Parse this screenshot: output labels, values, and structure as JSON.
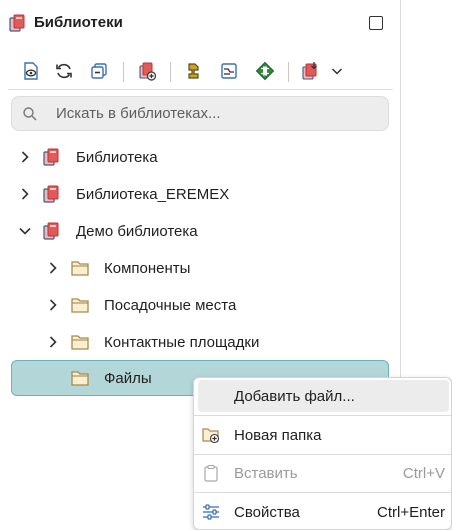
{
  "header": {
    "title": "Библиотеки",
    "icon": "library-books-icon"
  },
  "toolbar": {
    "buttons": [
      {
        "name": "view-library-icon"
      },
      {
        "name": "refresh-icon"
      },
      {
        "name": "collapse-all-icon"
      },
      {
        "name": "add-library-icon"
      },
      {
        "name": "component-icon"
      },
      {
        "name": "schematic-symbol-icon"
      },
      {
        "name": "footprint-icon"
      },
      {
        "name": "import-icon"
      },
      {
        "name": "chevron-down-icon"
      }
    ]
  },
  "search": {
    "placeholder": "Искать в библиотеках..."
  },
  "tree": {
    "items": [
      {
        "label": "Библиотека",
        "expanded": false,
        "type": "library"
      },
      {
        "label": "Библиотека_EREMEX",
        "expanded": false,
        "type": "library"
      },
      {
        "label": "Демо библиотека",
        "expanded": true,
        "type": "library"
      },
      {
        "label": "Компоненты",
        "expanded": false,
        "type": "folder"
      },
      {
        "label": "Посадочные места",
        "expanded": false,
        "type": "folder"
      },
      {
        "label": "Контактные площадки",
        "expanded": false,
        "type": "folder"
      },
      {
        "label": "Файлы",
        "expanded": false,
        "type": "folder",
        "selected": true
      }
    ]
  },
  "context_menu": {
    "items": [
      {
        "label": "Добавить файл...",
        "shortcut": "",
        "icon": "",
        "hover": true,
        "disabled": false
      },
      {
        "label": "Новая папка",
        "shortcut": "",
        "icon": "new-folder-icon",
        "disabled": false
      },
      {
        "label": "Вставить",
        "shortcut": "Ctrl+V",
        "icon": "paste-icon",
        "disabled": true
      },
      {
        "label": "Свойства",
        "shortcut": "Ctrl+Enter",
        "icon": "properties-sliders-icon",
        "disabled": false
      }
    ]
  },
  "colors": {
    "selection_bg": "#b3d7d9",
    "selection_border": "#6fb3b8",
    "library_red": "#d9534f",
    "folder_tan": "#a88a4e"
  }
}
